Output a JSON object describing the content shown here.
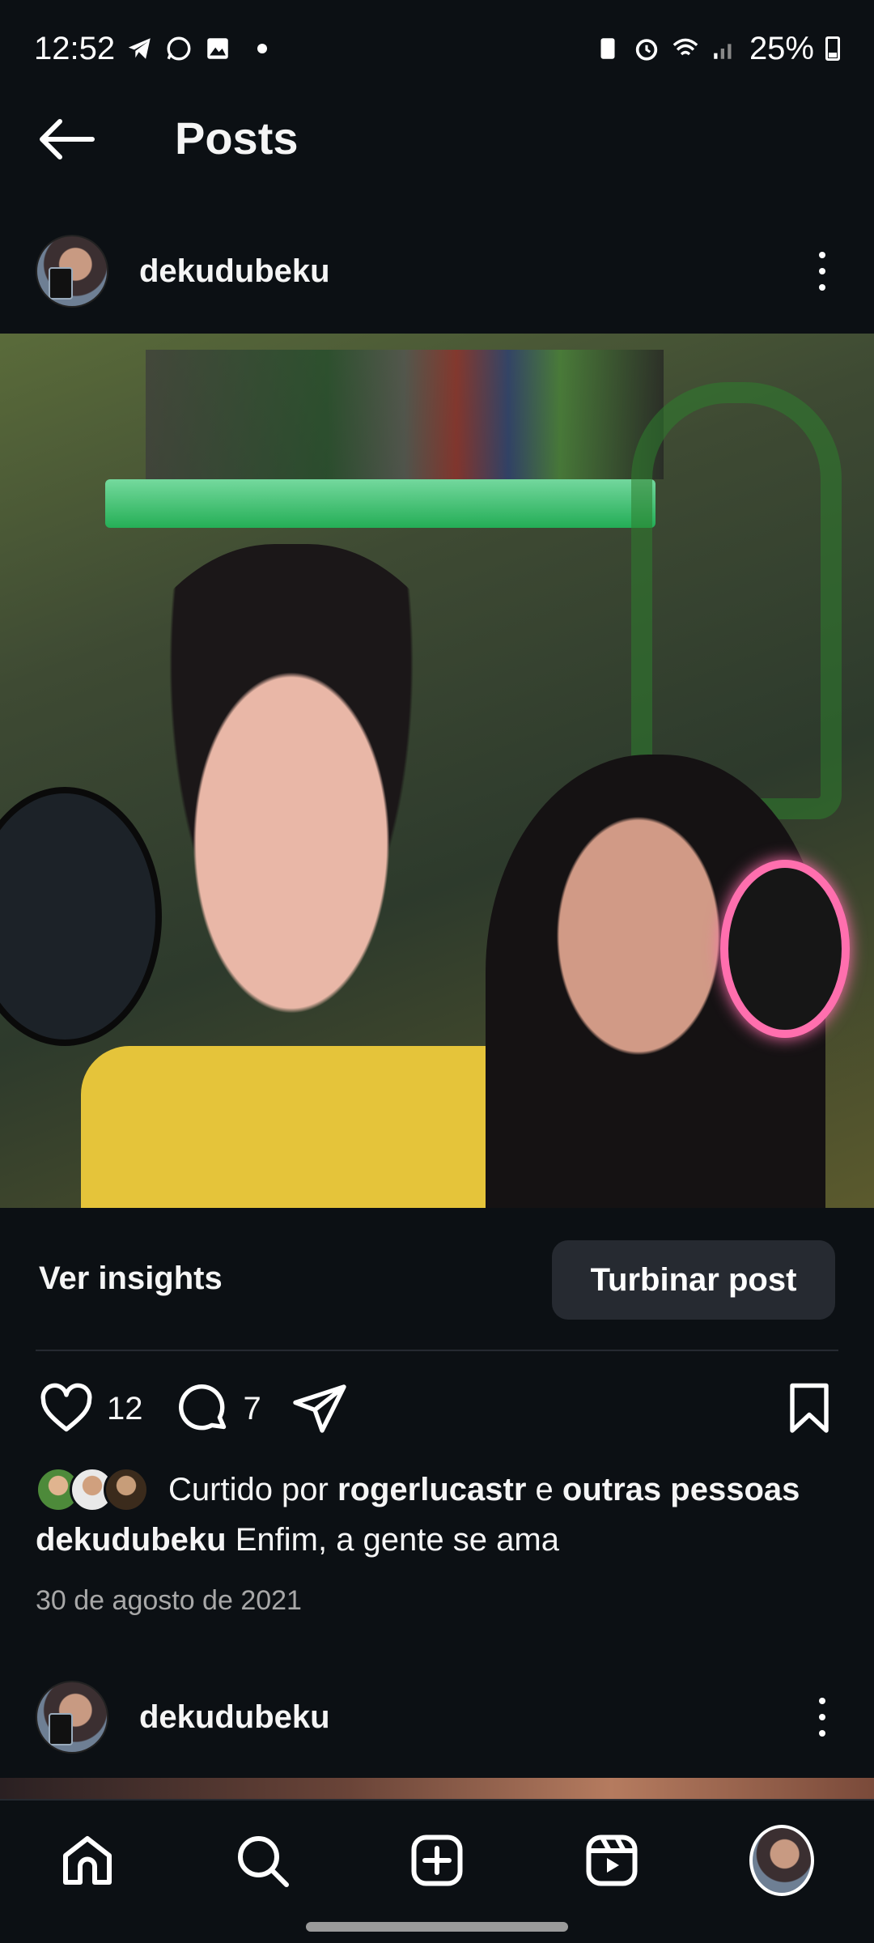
{
  "status_bar": {
    "time": "12:52",
    "battery": "25%",
    "left_icons": [
      "telegram-icon",
      "whatsapp-icon",
      "gallery-icon",
      "dot-icon"
    ],
    "right_icons": [
      "battery-saver-icon",
      "alarm-icon",
      "wifi-icon",
      "signal-icon",
      "battery-icon"
    ]
  },
  "header": {
    "title": "Posts"
  },
  "post": {
    "username": "dekudubeku",
    "insights_label": "Ver insights",
    "boost_label": "Turbinar post",
    "likes_count": "12",
    "comments_count": "7",
    "liked_by_prefix": "Curtido por",
    "liked_by_user": "rogerlucastr",
    "liked_by_connector": "e",
    "liked_by_others": "outras pessoas",
    "caption_user": "dekudubeku",
    "caption_text": "Enfim, a gente se ama",
    "date": "30 de agosto de 2021"
  },
  "next_post": {
    "username": "dekudubeku"
  },
  "bottom_nav": {
    "items": [
      "home-icon",
      "search-icon",
      "create-icon",
      "reels-icon",
      "profile-avatar"
    ]
  },
  "colors": {
    "background": "#0c1014",
    "button_bg": "#262a31",
    "text": "#f5f5f5",
    "muted": "#a8a8a8"
  }
}
